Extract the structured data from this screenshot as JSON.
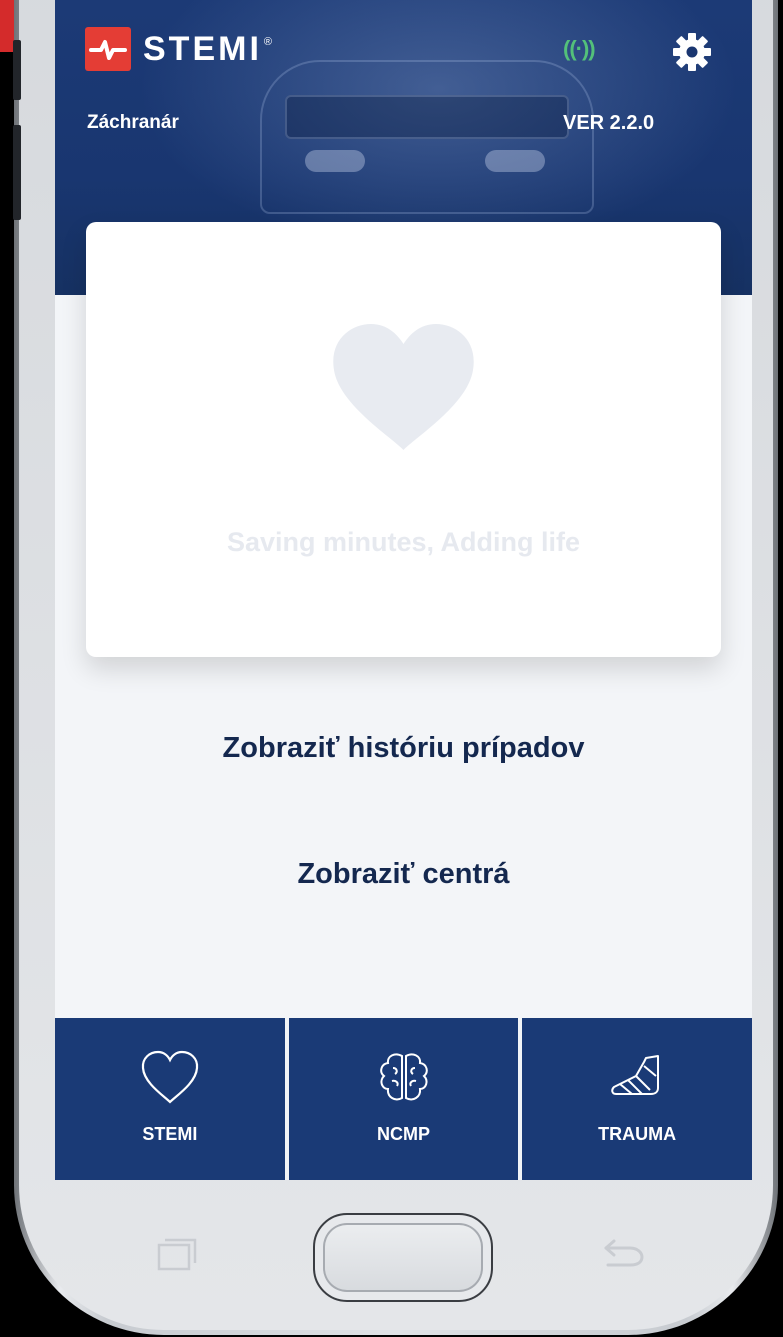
{
  "app": {
    "brand": "STEMI",
    "role": "Záchranár",
    "version": "VER 2.2.0",
    "signal_glyph": "((·))"
  },
  "card": {
    "tagline": "Saving minutes, Adding life"
  },
  "actions": {
    "history": "Zobraziť históriu prípadov",
    "centers": "Zobraziť centrá"
  },
  "tabs": [
    {
      "label": "STEMI",
      "icon": "heart-icon"
    },
    {
      "label": "NCMP",
      "icon": "brain-icon"
    },
    {
      "label": "TRAUMA",
      "icon": "cast-foot-icon"
    }
  ],
  "colors": {
    "brand_red": "#e43d35",
    "primary_navy": "#1a3a76",
    "signal_green": "#53c07a"
  }
}
